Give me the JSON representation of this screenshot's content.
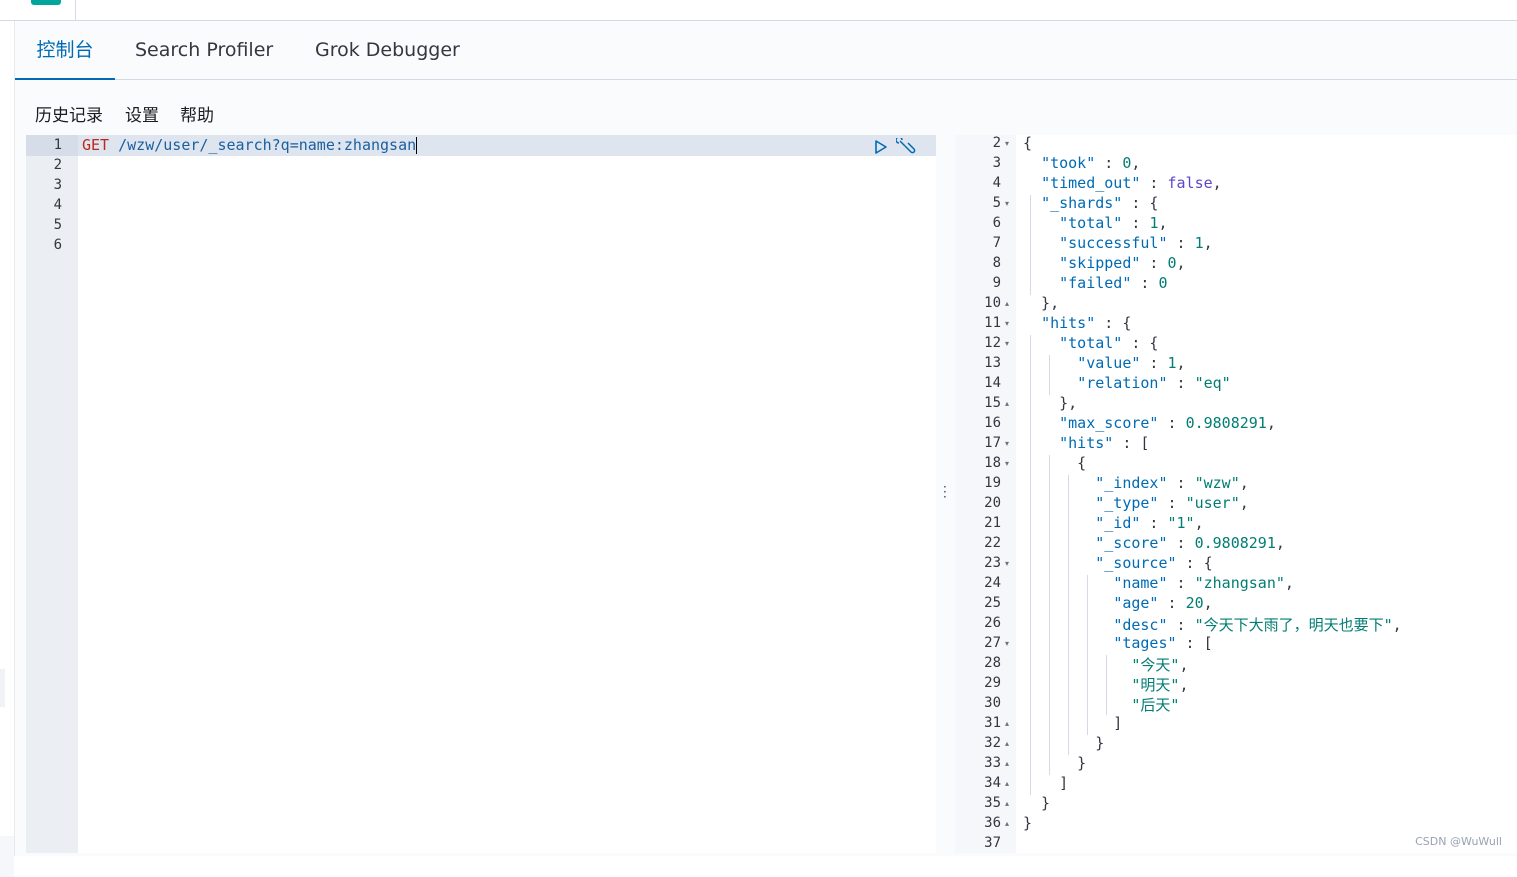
{
  "tabs": [
    {
      "label": "控制台",
      "active": true
    },
    {
      "label": "Search Profiler",
      "active": false
    },
    {
      "label": "Grok Debugger",
      "active": false
    }
  ],
  "menu": {
    "history": "历史记录",
    "settings": "设置",
    "help": "帮助"
  },
  "request": {
    "method": "GET",
    "path": "/wzw/user/_search?q=name:zhangsan",
    "line_numbers": [
      "1",
      "2",
      "3",
      "4",
      "5",
      "6"
    ]
  },
  "response": {
    "lines": [
      {
        "n": "2",
        "fold": "▾",
        "html": "{"
      },
      {
        "n": "3",
        "fold": "",
        "html": "  <span class='k'>\"took\"</span> : <span class='n'>0</span>,"
      },
      {
        "n": "4",
        "fold": "",
        "html": "  <span class='k'>\"timed_out\"</span> : <span class='b'>false</span>,"
      },
      {
        "n": "5",
        "fold": "▾",
        "html": "  <span class='k'>\"_shards\"</span> : {"
      },
      {
        "n": "6",
        "fold": "",
        "html": "    <span class='k'>\"total\"</span> : <span class='n'>1</span>,"
      },
      {
        "n": "7",
        "fold": "",
        "html": "    <span class='k'>\"successful\"</span> : <span class='n'>1</span>,"
      },
      {
        "n": "8",
        "fold": "",
        "html": "    <span class='k'>\"skipped\"</span> : <span class='n'>0</span>,"
      },
      {
        "n": "9",
        "fold": "",
        "html": "    <span class='k'>\"failed\"</span> : <span class='n'>0</span>"
      },
      {
        "n": "10",
        "fold": "▴",
        "html": "  },"
      },
      {
        "n": "11",
        "fold": "▾",
        "html": "  <span class='k'>\"hits\"</span> : {"
      },
      {
        "n": "12",
        "fold": "▾",
        "html": "    <span class='k'>\"total\"</span> : {"
      },
      {
        "n": "13",
        "fold": "",
        "html": "      <span class='k'>\"value\"</span> : <span class='n'>1</span>,"
      },
      {
        "n": "14",
        "fold": "",
        "html": "      <span class='k'>\"relation\"</span> : <span class='s'>\"eq\"</span>"
      },
      {
        "n": "15",
        "fold": "▴",
        "html": "    },"
      },
      {
        "n": "16",
        "fold": "",
        "html": "    <span class='k'>\"max_score\"</span> : <span class='n'>0.9808291</span>,"
      },
      {
        "n": "17",
        "fold": "▾",
        "html": "    <span class='k'>\"hits\"</span> : ["
      },
      {
        "n": "18",
        "fold": "▾",
        "html": "      {"
      },
      {
        "n": "19",
        "fold": "",
        "html": "        <span class='k'>\"_index\"</span> : <span class='s'>\"wzw\"</span>,"
      },
      {
        "n": "20",
        "fold": "",
        "html": "        <span class='k'>\"_type\"</span> : <span class='s'>\"user\"</span>,"
      },
      {
        "n": "21",
        "fold": "",
        "html": "        <span class='k'>\"_id\"</span> : <span class='s'>\"1\"</span>,"
      },
      {
        "n": "22",
        "fold": "",
        "html": "        <span class='k'>\"_score\"</span> : <span class='n'>0.9808291</span>,"
      },
      {
        "n": "23",
        "fold": "▾",
        "html": "        <span class='k'>\"_source\"</span> : {"
      },
      {
        "n": "24",
        "fold": "",
        "html": "          <span class='k'>\"name\"</span> : <span class='s'>\"zhangsan\"</span>,"
      },
      {
        "n": "25",
        "fold": "",
        "html": "          <span class='k'>\"age\"</span> : <span class='n'>20</span>,"
      },
      {
        "n": "26",
        "fold": "",
        "html": "          <span class='k'>\"desc\"</span> : <span class='s'>\"今天下大雨了，明天也要下\"</span>,"
      },
      {
        "n": "27",
        "fold": "▾",
        "html": "          <span class='k'>\"tages\"</span> : ["
      },
      {
        "n": "28",
        "fold": "",
        "html": "            <span class='s'>\"今天\"</span>,"
      },
      {
        "n": "29",
        "fold": "",
        "html": "            <span class='s'>\"明天\"</span>,"
      },
      {
        "n": "30",
        "fold": "",
        "html": "            <span class='s'>\"后天\"</span>"
      },
      {
        "n": "31",
        "fold": "▴",
        "html": "          ]"
      },
      {
        "n": "32",
        "fold": "▴",
        "html": "        }"
      },
      {
        "n": "33",
        "fold": "▴",
        "html": "      }"
      },
      {
        "n": "34",
        "fold": "▴",
        "html": "    ]"
      },
      {
        "n": "35",
        "fold": "▴",
        "html": "  }"
      },
      {
        "n": "36",
        "fold": "▴",
        "html": "}"
      },
      {
        "n": "37",
        "fold": "",
        "html": ""
      }
    ]
  },
  "watermark": "CSDN @WuWull"
}
